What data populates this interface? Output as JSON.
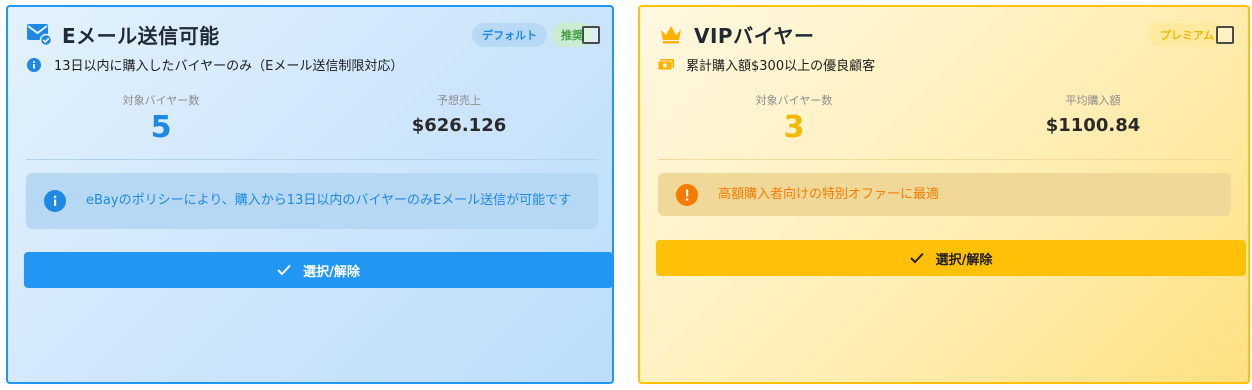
{
  "email_card": {
    "title": "Eメール送信可能",
    "icon": "email-check-icon",
    "chips": {
      "default": "デフォルト",
      "recommended": "推奨"
    },
    "subtitle_icon": "info-icon",
    "subtitle": "13日以内に購入したバイヤーのみ（Eメール送信制限対応）",
    "stats": {
      "buyers_label": "対象バイヤー数",
      "buyers_value": "5",
      "sales_label": "予想売上",
      "sales_value": "$626.126"
    },
    "notice_icon": "info-icon",
    "notice": "eBayのポリシーにより、購入から13日以内のバイヤーのみEメール送信が可能です",
    "button_label": "選択/解除",
    "selected": false,
    "colors": {
      "accent": "#2196f3",
      "value": "#1e88e5"
    }
  },
  "vip_card": {
    "title": "VIPバイヤー",
    "icon": "crown-icon",
    "chips": {
      "premium": "プレミアム"
    },
    "subtitle_icon": "cash-icon",
    "subtitle": "累計購入額$300以上の優良顧客",
    "stats": {
      "buyers_label": "対象バイヤー数",
      "buyers_value": "3",
      "avg_label": "平均購入額",
      "avg_value": "$1100.84"
    },
    "notice_icon": "alert-icon",
    "notice": "高額購入者向けの特別オファーに最適",
    "button_label": "選択/解除",
    "selected": false,
    "colors": {
      "accent": "#ffc107",
      "value": "#f5b800",
      "notice_text": "#f57c00"
    }
  }
}
